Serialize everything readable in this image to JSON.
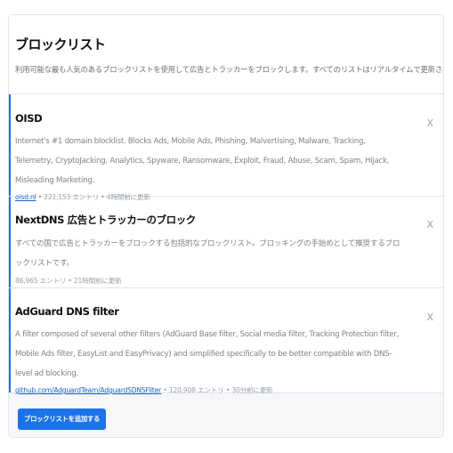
{
  "header": {
    "title": "ブロックリスト",
    "subtitle": "利用可能な最も人気のあるブロックリストを使用して広告とトラッカーをブロックします。すべてのリストはリアルタイムで更新されます。"
  },
  "blocklists": [
    {
      "name": "OISD",
      "description": "Internet's #1 domain blocklist. Blocks Ads, Mobile Ads, Phishing, Malvertising, Malware, Tracking, Telemetry, CryptoJacking, Analytics, Spyware, Ransomware, Exploit, Fraud, Abuse, Scam, Spam, Hijack, Misleading Marketing.",
      "link": "oisd.nl",
      "meta": " • 221,153 エントリ • 4時間前に更新",
      "remove_label": "X"
    },
    {
      "name": "NextDNS 広告とトラッカーのブロック",
      "description": "すべての国で広告とトラッカーをブロックする包括的なブロックリスト。ブロッキングの手始めとして推奨するブロックリストです。",
      "link": "",
      "meta": "86,965 エントリ • 21時間前に更新",
      "remove_label": "X"
    },
    {
      "name": "AdGuard DNS filter",
      "description": "A filter composed of several other filters (AdGuard Base filter, Social media filter, Tracking Protection filter, Mobile Ads filter, EasyList and EasyPrivacy) and simplified specifically to be better compatible with DNS-level ad blocking.",
      "link": "github.com/AdguardTeam/AdguardSDNSFilter",
      "meta": " • 120,908 エントリ • 30分前に更新",
      "remove_label": "X"
    }
  ],
  "footer": {
    "add_button_label": "ブロックリストを追加する"
  },
  "colors": {
    "accent": "#1a73e8",
    "link": "#1a5fd0",
    "muted_text": "#7d828a",
    "border": "#e3e5e8"
  }
}
